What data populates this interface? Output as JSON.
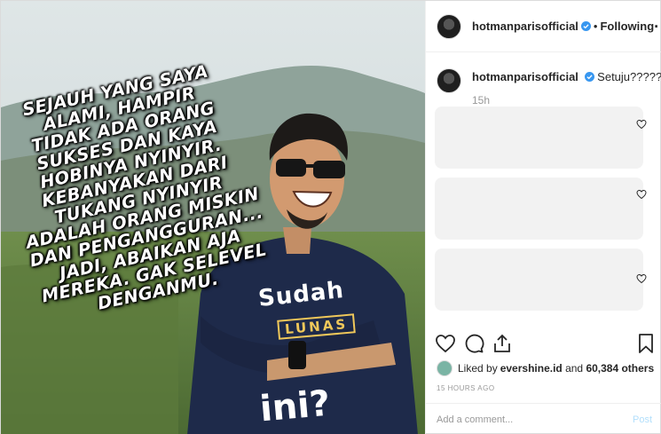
{
  "photo": {
    "meme_text": "SEJAUH YANG SAYA\nALAMI, HAMPIR\nTIDAK ADA ORANG\nSUKSES DAN KAYA\nHOBINYA NYINYIR.\nKEBANYAKAN DARI\nTUKANG NYINYIR\nADALAH ORANG MISKIN\nDAN PENGANGGURAN...\nJADI, ABAIKAN AJA\nMEREKA. GAK SELEVEL\nDENGANMU.",
    "shirt_line1": "Sudah",
    "shirt_line2": "LUNAS",
    "shirt_line3": "ini?"
  },
  "header": {
    "username": "hotmanparisofficial",
    "separator": "•",
    "follow_status": "Following",
    "more_label": "···"
  },
  "caption": {
    "username": "hotmanparisofficial",
    "text": "Setuju?????",
    "time": "15h"
  },
  "likes": {
    "prefix": "Liked by ",
    "user": "evershine.id",
    "middle": " and ",
    "others": "60,384 others"
  },
  "timestamp": "15 HOURS AGO",
  "comment_input": {
    "placeholder": "Add a comment...",
    "post_label": "Post"
  },
  "colors": {
    "verified_blue": "#3897f0",
    "post_disabled": "#b2dffc",
    "muted_gray": "#999999"
  }
}
